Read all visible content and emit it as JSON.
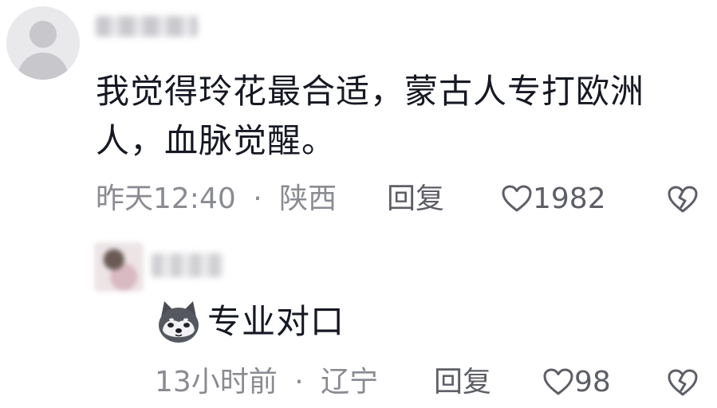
{
  "main_comment": {
    "text": "我觉得玲花最合适，蒙古人专打欧洲人，血脉觉醒。",
    "time": "昨天12:40",
    "separator": "·",
    "location": "陕西",
    "reply_label": "回复",
    "like_count": "1982",
    "icons": {
      "avatar": "default-avatar-icon",
      "like": "heart-outline-icon",
      "dislike": "broken-heart-icon"
    }
  },
  "reply_comment": {
    "text": "专业对口",
    "emoji": "dog-emoji-icon",
    "time": "13小时前",
    "separator": "·",
    "location": "辽宁",
    "reply_label": "回复",
    "like_count": "98",
    "icons": {
      "like": "heart-outline-icon",
      "dislike": "broken-heart-icon"
    }
  },
  "colors": {
    "text_primary": "#161823",
    "text_secondary": "#8a8b91",
    "action": "#5d5e66"
  }
}
